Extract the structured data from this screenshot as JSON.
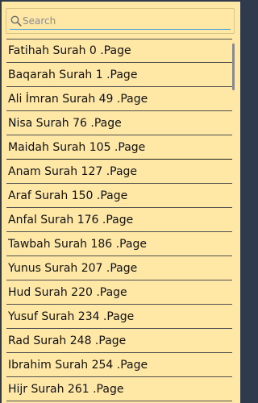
{
  "search": {
    "placeholder": "Search",
    "value": ""
  },
  "surahs": [
    {
      "label": "Fatihah Surah 0 .Page"
    },
    {
      "label": "Baqarah Surah 1 .Page"
    },
    {
      "label": "Ali İmran Surah 49 .Page"
    },
    {
      "label": "Nisa Surah 76 .Page"
    },
    {
      "label": "Maidah Surah 105 .Page"
    },
    {
      "label": "Anam Surah 127 .Page"
    },
    {
      "label": "Araf Surah 150 .Page"
    },
    {
      "label": "Anfal Surah 176 .Page"
    },
    {
      "label": "Tawbah Surah 186 .Page"
    },
    {
      "label": "Yunus Surah 207 .Page"
    },
    {
      "label": "Hud Surah 220 .Page"
    },
    {
      "label": "Yusuf Surah 234 .Page"
    },
    {
      "label": "Rad Surah 248 .Page"
    },
    {
      "label": "Ibrahim Surah 254 .Page"
    },
    {
      "label": "Hijr Surah 261 .Page"
    }
  ]
}
